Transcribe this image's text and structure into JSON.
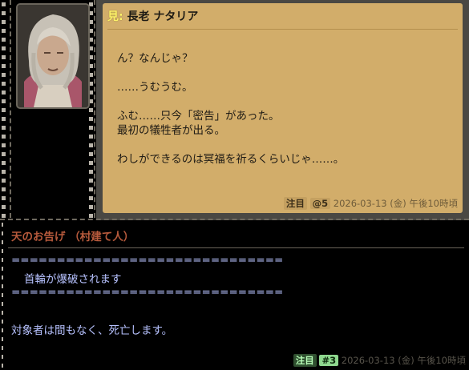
{
  "speaker": {
    "mark": "見:",
    "name": "長老 ナタリア",
    "portrait_icon": "elder-woman-portrait"
  },
  "bubble": {
    "lines": [
      "ん？なんじゃ？",
      "",
      "……うむうむ。",
      "",
      "ふむ……只今「密告」があった。",
      "最初の犠牲者が出る。",
      "",
      "わしができるのは冥福を祈るくらいじゃ……。"
    ],
    "note_tag": "注目",
    "anchor_tag": "@5",
    "timestamp": "2026-03-13 (金) 午後10時頃"
  },
  "announcement": {
    "title": "天のお告げ （村建て人）",
    "separator": "==============================",
    "message": "首輪が爆破されます",
    "body": "対象者は間もなく、死亡します。",
    "note_tag": "注目",
    "anchor_tag": "#3",
    "timestamp": "2026-03-13 (金) 午後10時頃"
  },
  "colors": {
    "bubble_bg": "#d2ad6a",
    "panel_bg": "#000000",
    "title_red": "#b75a3c",
    "message_blue": "#b7c2ff",
    "tag_green": "#8fd88f"
  }
}
